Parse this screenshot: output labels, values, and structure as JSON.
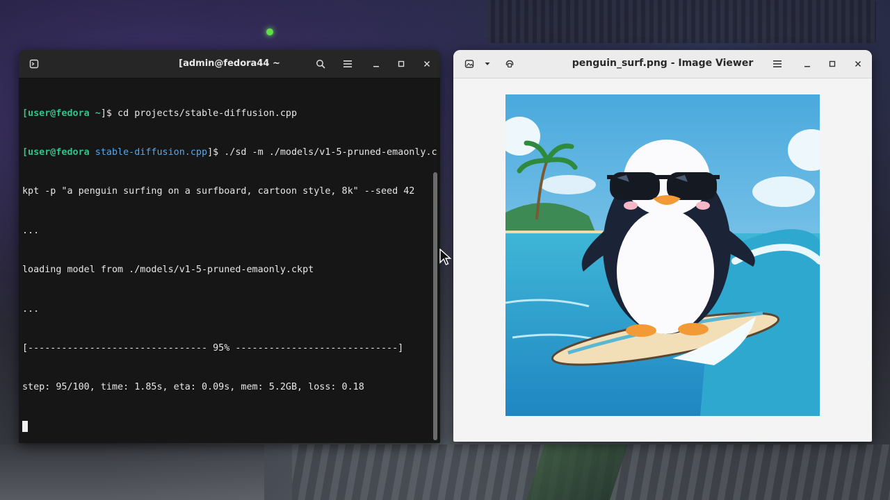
{
  "terminal": {
    "title": "[admin@fedora44 ~",
    "lines": [
      {
        "user": "[user@fedora",
        "dir": " ~",
        "rest": "]$ cd projects/stable-diffusion.cpp"
      },
      {
        "user": "[user@fedora",
        "dir": " stable-diffusion.cpp",
        "rest": "]$ ./sd -m ./models/v1-5-pruned-emaonly.c"
      },
      {
        "text": "kpt -p \"a penguin surfing on a surfboard, cartoon style, 8k\" --seed 42"
      },
      {
        "text": "..."
      },
      {
        "text": "loading model from ./models/v1-5-pruned-emaonly.ckpt"
      },
      {
        "text": "..."
      },
      {
        "text": "[-------------------------------- 95% -----------------------------]"
      },
      {
        "text": "step: 95/100, time: 1.85s, eta: 0.09s, mem: 5.2GB, loss: 0.18"
      }
    ]
  },
  "viewer": {
    "title": "penguin_surf.png - Image Viewer"
  },
  "colors": {
    "prompt_green": "#33c18c",
    "dir_blue": "#5aa6e8",
    "terminal_bg": "#161616",
    "viewer_bg": "#f4f4f4"
  },
  "icons": {
    "terminal_header": [
      "new-tab-icon",
      "search-icon",
      "hamburger-menu-icon",
      "minimize-icon",
      "maximize-icon",
      "close-icon"
    ],
    "viewer_header": [
      "gallery-icon",
      "chevron-down-icon",
      "rotate-icon",
      "hamburger-menu-icon",
      "minimize-icon",
      "maximize-icon",
      "close-icon"
    ]
  }
}
